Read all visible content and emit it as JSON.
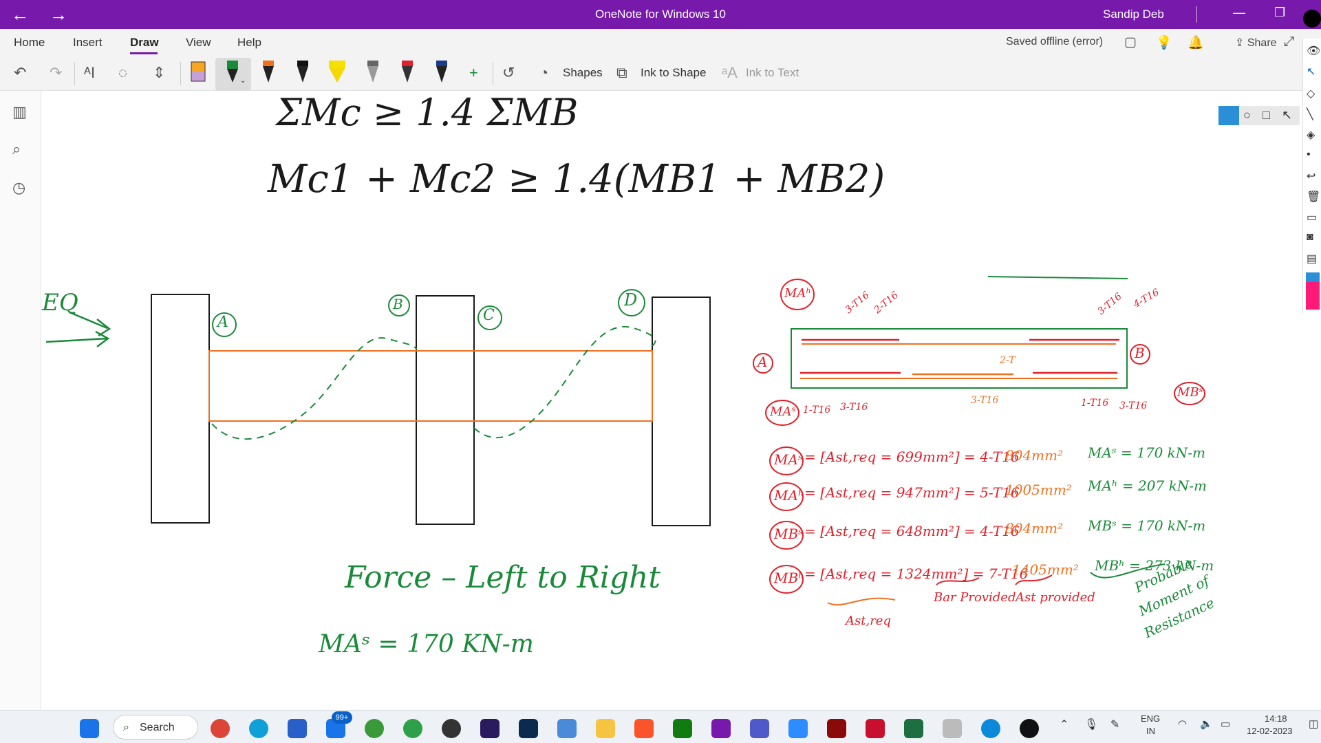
{
  "titlebar": {
    "app_title": "OneNote for Windows 10",
    "user": "Sandip Deb",
    "back_icon": "back-arrow-icon",
    "forward_icon": "forward-arrow-icon"
  },
  "menu": {
    "tabs": [
      "Home",
      "Insert",
      "Draw",
      "View",
      "Help"
    ],
    "active_tab": "Draw",
    "status": "Saved offline (error)",
    "share_label": "Share"
  },
  "ribbon": {
    "shapes_label": "Shapes",
    "ink_to_shape_label": "Ink to Shape",
    "ink_to_text_label": "Ink to Text"
  },
  "notes": {
    "eq1": "ΣMc ≥ 1.4 ΣMB",
    "eq2": "Mc1 + Mc2 ≥ 1.4(MB1 + MB2)",
    "eq_label": "EQ",
    "node_a": "A",
    "node_b": "B",
    "node_c": "C",
    "node_d": "D",
    "force_text": "Force – Left to Right",
    "ma_result": "MAˢ = 170 KN-m",
    "beam_label_a": "A",
    "beam_label_b": "B",
    "ma_h": "MAʰ",
    "ma_s": "MAˢ",
    "mb_s": "MBˢ",
    "top_left_bars1": "3-T16",
    "top_left_bars2": "2-T16",
    "top_right_bars1": "3-T16",
    "top_right_bars2": "4-T16",
    "bot_bars1": "1-T16",
    "bot_bars2": "3-T16",
    "bot_mid_bars": "3-T16",
    "bot_mid_top": "2-T",
    "bot_right1": "1-T16",
    "bot_right2": "3-T16",
    "rows": [
      {
        "label": "MAˢ",
        "eq": "= [Ast,req = 699mm²] = 4-T16",
        "area": "804mm²",
        "result": "MAˢ = 170 kN-m"
      },
      {
        "label": "MAʰ",
        "eq": "= [Ast,req = 947mm²] = 5-T16",
        "area": "1005mm²",
        "result": "MAʰ = 207 kN-m"
      },
      {
        "label": "MBˢ",
        "eq": "= [Ast,req = 648mm²] = 4-T16",
        "area": "804mm²",
        "result": "MBˢ = 170 kN-m"
      },
      {
        "label": "MBʰ",
        "eq": "= [Ast,req = 1324mm²] = 7-T16",
        "area": "1405mm²",
        "result": "MBʰ = 273 kN-m"
      }
    ],
    "ast_req": "Ast,req",
    "bar_provided": "Bar Provided",
    "ast_provided": "Ast provided",
    "probable": "Probable",
    "moment_of": "Moment of",
    "resistance": "Resistance"
  },
  "taskbar": {
    "search_label": "Search",
    "mail_badge": "99+",
    "lang": "ENG",
    "region": "IN",
    "time": "14:18",
    "date": "12-02-2023"
  },
  "colors": {
    "accent": "#7719aa",
    "ink_green": "#1a8a3a",
    "ink_red": "#e0202a",
    "ink_orange": "#f07020"
  }
}
